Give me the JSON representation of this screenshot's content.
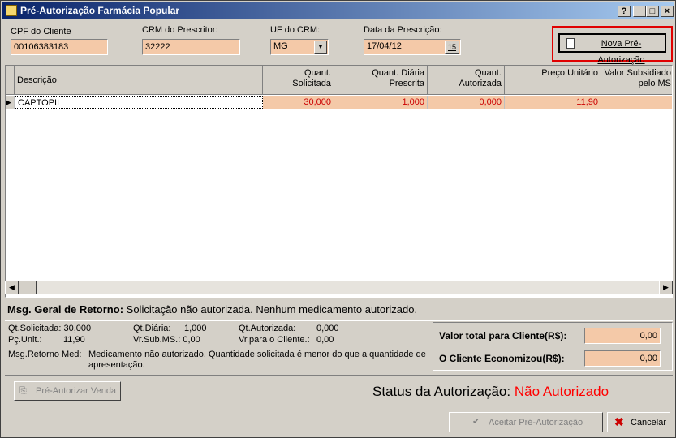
{
  "window": {
    "title": "Pré-Autorização Farmácia Popular"
  },
  "form": {
    "cpf_label": "CPF do Cliente",
    "cpf_value": "00106383183",
    "crm_label": "CRM do Prescritor:",
    "crm_value": "32222",
    "uf_label": "UF do CRM:",
    "uf_value": "MG",
    "date_label": "Data da Prescrição:",
    "date_value": "17/04/12",
    "date_icon": "15",
    "nova_button": "Nova Pré-Autorização"
  },
  "grid": {
    "headers": [
      "Descrição",
      "Quant. Solicitada",
      "Quant. Diária Prescrita",
      "Quant. Autorizada",
      "Preço Unitário",
      "Valor Subsidiado pelo MS"
    ],
    "row": [
      "CAPTOPIL",
      "30,000",
      "1,000",
      "0,000",
      "11,90",
      ""
    ]
  },
  "msg": {
    "label": "Msg. Geral de Retorno:",
    "text": "Solicitação não autorizada. Nenhum medicamento autorizado."
  },
  "details": {
    "qt_sol": "Qt.Solicitada: 30,000",
    "qt_dia": "Qt.Diária:",
    "qt_dia_v": "1,000",
    "qt_aut": "Qt.Autorizada:",
    "qt_aut_v": "0,000",
    "pc_unit": "Pç.Unit.:",
    "pc_unit_v": "11,90",
    "vr_sub": "Vr.Sub.MS.: 0,00",
    "vr_cli": "Vr.para o Cliente.:",
    "vr_cli_v": "0,00",
    "msg_med_label": "Msg.Retorno Med:",
    "msg_med_text": "Medicamento não autorizado. Quantidade solicitada é menor do que a quantidade de apresentação."
  },
  "totals": {
    "valor_label": "Valor total para Cliente(R$):",
    "valor_value": "0,00",
    "econ_label": "O Cliente Economizou(R$):",
    "econ_value": "0,00"
  },
  "actions": {
    "pre_autorizar": "Pré-Autorizar Venda",
    "status_label": "Status da Autorização:",
    "status_value": "Não Autorizado",
    "aceitar": "Aceitar Pré-Autorização",
    "cancelar": "Cancelar"
  },
  "colors": {
    "status": "#ff0000",
    "highlight": "#e00000",
    "field": "#f4c9a8"
  }
}
